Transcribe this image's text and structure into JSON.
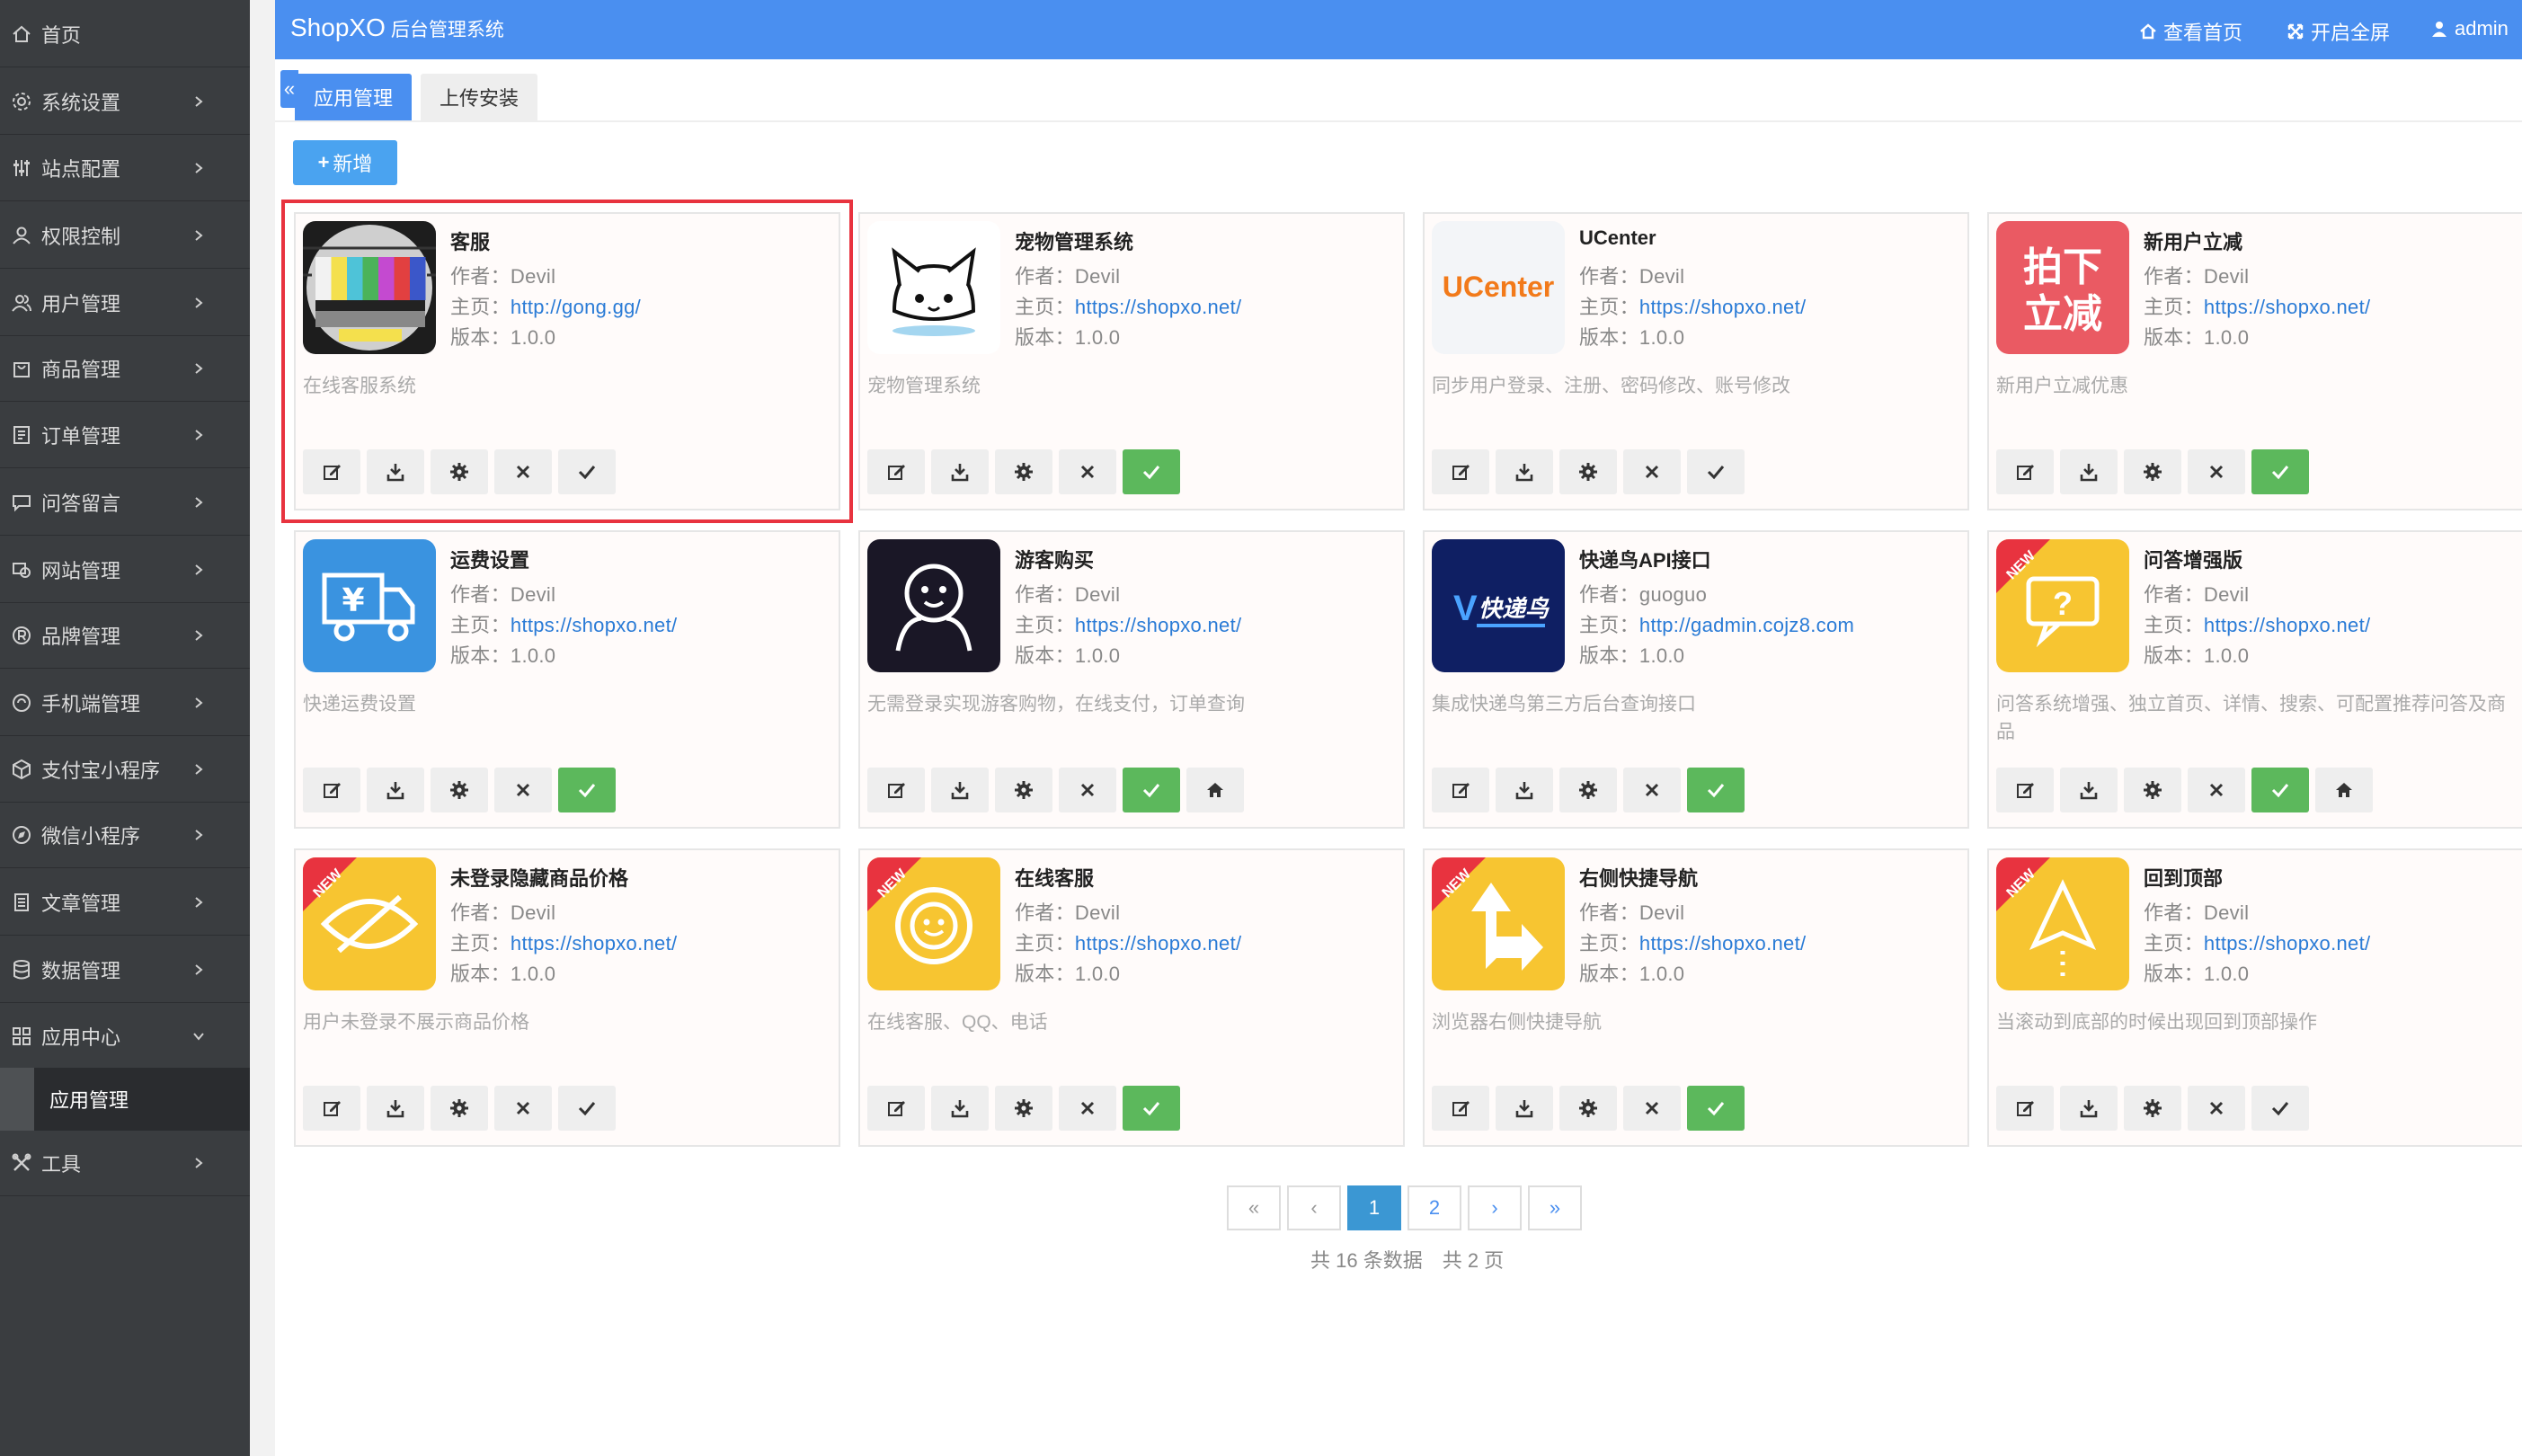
{
  "header": {
    "brand": "ShopXO",
    "brand_sub": "后台管理系统",
    "links": [
      {
        "label": "查看首页",
        "icon": "home-icon"
      },
      {
        "label": "开启全屏",
        "icon": "fullscreen-icon"
      },
      {
        "label": "admin",
        "icon": "user-icon"
      }
    ]
  },
  "sidebar": {
    "items": [
      {
        "label": "首页",
        "icon": "home-icon",
        "expandable": false
      },
      {
        "label": "系统设置",
        "icon": "gear-icon",
        "expandable": true
      },
      {
        "label": "站点配置",
        "icon": "sliders-icon",
        "expandable": true
      },
      {
        "label": "权限控制",
        "icon": "user-icon",
        "expandable": true
      },
      {
        "label": "用户管理",
        "icon": "users-icon",
        "expandable": true
      },
      {
        "label": "商品管理",
        "icon": "shopping-bag-icon",
        "expandable": true
      },
      {
        "label": "订单管理",
        "icon": "list-icon",
        "expandable": true
      },
      {
        "label": "问答留言",
        "icon": "comment-icon",
        "expandable": true
      },
      {
        "label": "网站管理",
        "icon": "globe-icon",
        "expandable": true
      },
      {
        "label": "品牌管理",
        "icon": "registered-icon",
        "expandable": true
      },
      {
        "label": "手机端管理",
        "icon": "mobile-icon",
        "expandable": true
      },
      {
        "label": "支付宝小程序",
        "icon": "cube-icon",
        "expandable": true
      },
      {
        "label": "微信小程序",
        "icon": "compass-icon",
        "expandable": true
      },
      {
        "label": "文章管理",
        "icon": "document-icon",
        "expandable": true
      },
      {
        "label": "数据管理",
        "icon": "database-icon",
        "expandable": true
      },
      {
        "label": "应用中心",
        "icon": "apps-icon",
        "expandable": true,
        "expanded": true
      },
      {
        "label": "工具",
        "icon": "tools-icon",
        "expandable": true
      }
    ],
    "active_sub": "应用管理"
  },
  "tabs": [
    {
      "label": "应用管理",
      "active": true
    },
    {
      "label": "上传安装",
      "active": false
    }
  ],
  "add_button": "新增",
  "labels": {
    "author": "作者：",
    "homepage": "主页：",
    "version": "版本："
  },
  "apps": [
    {
      "name": "客服",
      "author": "Devil",
      "url": "http://gong.gg/",
      "version": "1.0.0",
      "desc": "在线客服系统",
      "enabled": false,
      "has_home": false,
      "selected": true,
      "logo": "test-pattern-logo",
      "new": false
    },
    {
      "name": "宠物管理系统",
      "author": "Devil",
      "url": "https://shopxo.net/",
      "version": "1.0.0",
      "desc": "宠物管理系统",
      "enabled": true,
      "has_home": false,
      "logo": "pet-cat-logo",
      "new": false
    },
    {
      "name": "UCenter",
      "author": "Devil",
      "url": "https://shopxo.net/",
      "version": "1.0.0",
      "desc": "同步用户登录、注册、密码修改、账号修改",
      "enabled": false,
      "has_home": false,
      "logo": "ucenter-logo",
      "logo_text": "UCenter",
      "new": false
    },
    {
      "name": "新用户立减",
      "author": "Devil",
      "url": "https://shopxo.net/",
      "version": "1.0.0",
      "desc": "新用户立减优惠",
      "enabled": true,
      "has_home": false,
      "logo": "discount-logo",
      "logo_text": [
        "拍下",
        "立减"
      ],
      "new": false
    },
    {
      "name": "运费设置",
      "author": "Devil",
      "url": "https://shopxo.net/",
      "version": "1.0.0",
      "desc": "快递运费设置",
      "enabled": true,
      "has_home": false,
      "logo": "delivery-truck-logo",
      "new": false
    },
    {
      "name": "游客购买",
      "author": "Devil",
      "url": "https://shopxo.net/",
      "version": "1.0.0",
      "desc": "无需登录实现游客购物，在线支付，订单查询",
      "enabled": true,
      "has_home": true,
      "logo": "guest-face-logo",
      "new": false
    },
    {
      "name": "快递鸟API接口",
      "author": "guoguo",
      "url": "http://gadmin.cojz8.com",
      "version": "1.0.0",
      "desc": "集成快递鸟第三方后台查询接口",
      "enabled": true,
      "has_home": false,
      "logo": "kdniao-logo",
      "logo_text": "快递鸟",
      "new": false
    },
    {
      "name": "问答增强版",
      "author": "Devil",
      "url": "https://shopxo.net/",
      "version": "1.0.0",
      "desc": "问答系统增强、独立首页、详情、搜索、可配置推荐问答及商品",
      "enabled": true,
      "has_home": true,
      "logo": "question-bubble-logo",
      "new": true
    },
    {
      "name": "未登录隐藏商品价格",
      "author": "Devil",
      "url": "https://shopxo.net/",
      "version": "1.0.0",
      "desc": "用户未登录不展示商品价格",
      "enabled": false,
      "has_home": false,
      "logo": "eye-slash-logo",
      "new": true
    },
    {
      "name": "在线客服",
      "author": "Devil",
      "url": "https://shopxo.net/",
      "version": "1.0.0",
      "desc": "在线客服、QQ、电话",
      "enabled": true,
      "has_home": false,
      "logo": "headset-logo",
      "new": true
    },
    {
      "name": "右侧快捷导航",
      "author": "Devil",
      "url": "https://shopxo.net/",
      "version": "1.0.0",
      "desc": "浏览器右侧快捷导航",
      "enabled": true,
      "has_home": false,
      "logo": "navigation-arrow-logo",
      "new": true
    },
    {
      "name": "回到顶部",
      "author": "Devil",
      "url": "https://shopxo.net/",
      "version": "1.0.0",
      "desc": "当滚动到底部的时候出现回到顶部操作",
      "enabled": false,
      "has_home": false,
      "logo": "back-to-top-logo",
      "new": true
    }
  ],
  "badge_text": "NEW",
  "pagination": {
    "first": "«",
    "prev": "‹",
    "pages": [
      "1",
      "2"
    ],
    "current": "1",
    "next": "›",
    "last": "»",
    "total_label": "共 16 条数据",
    "pages_label": "共 2 页"
  },
  "colors": {
    "primary": "#4a8ff0",
    "sidebar_bg": "#3a3d40",
    "enabled_green": "#5cb85c",
    "selected_outline": "#e8333f",
    "link_blue": "#2a7bd6"
  }
}
